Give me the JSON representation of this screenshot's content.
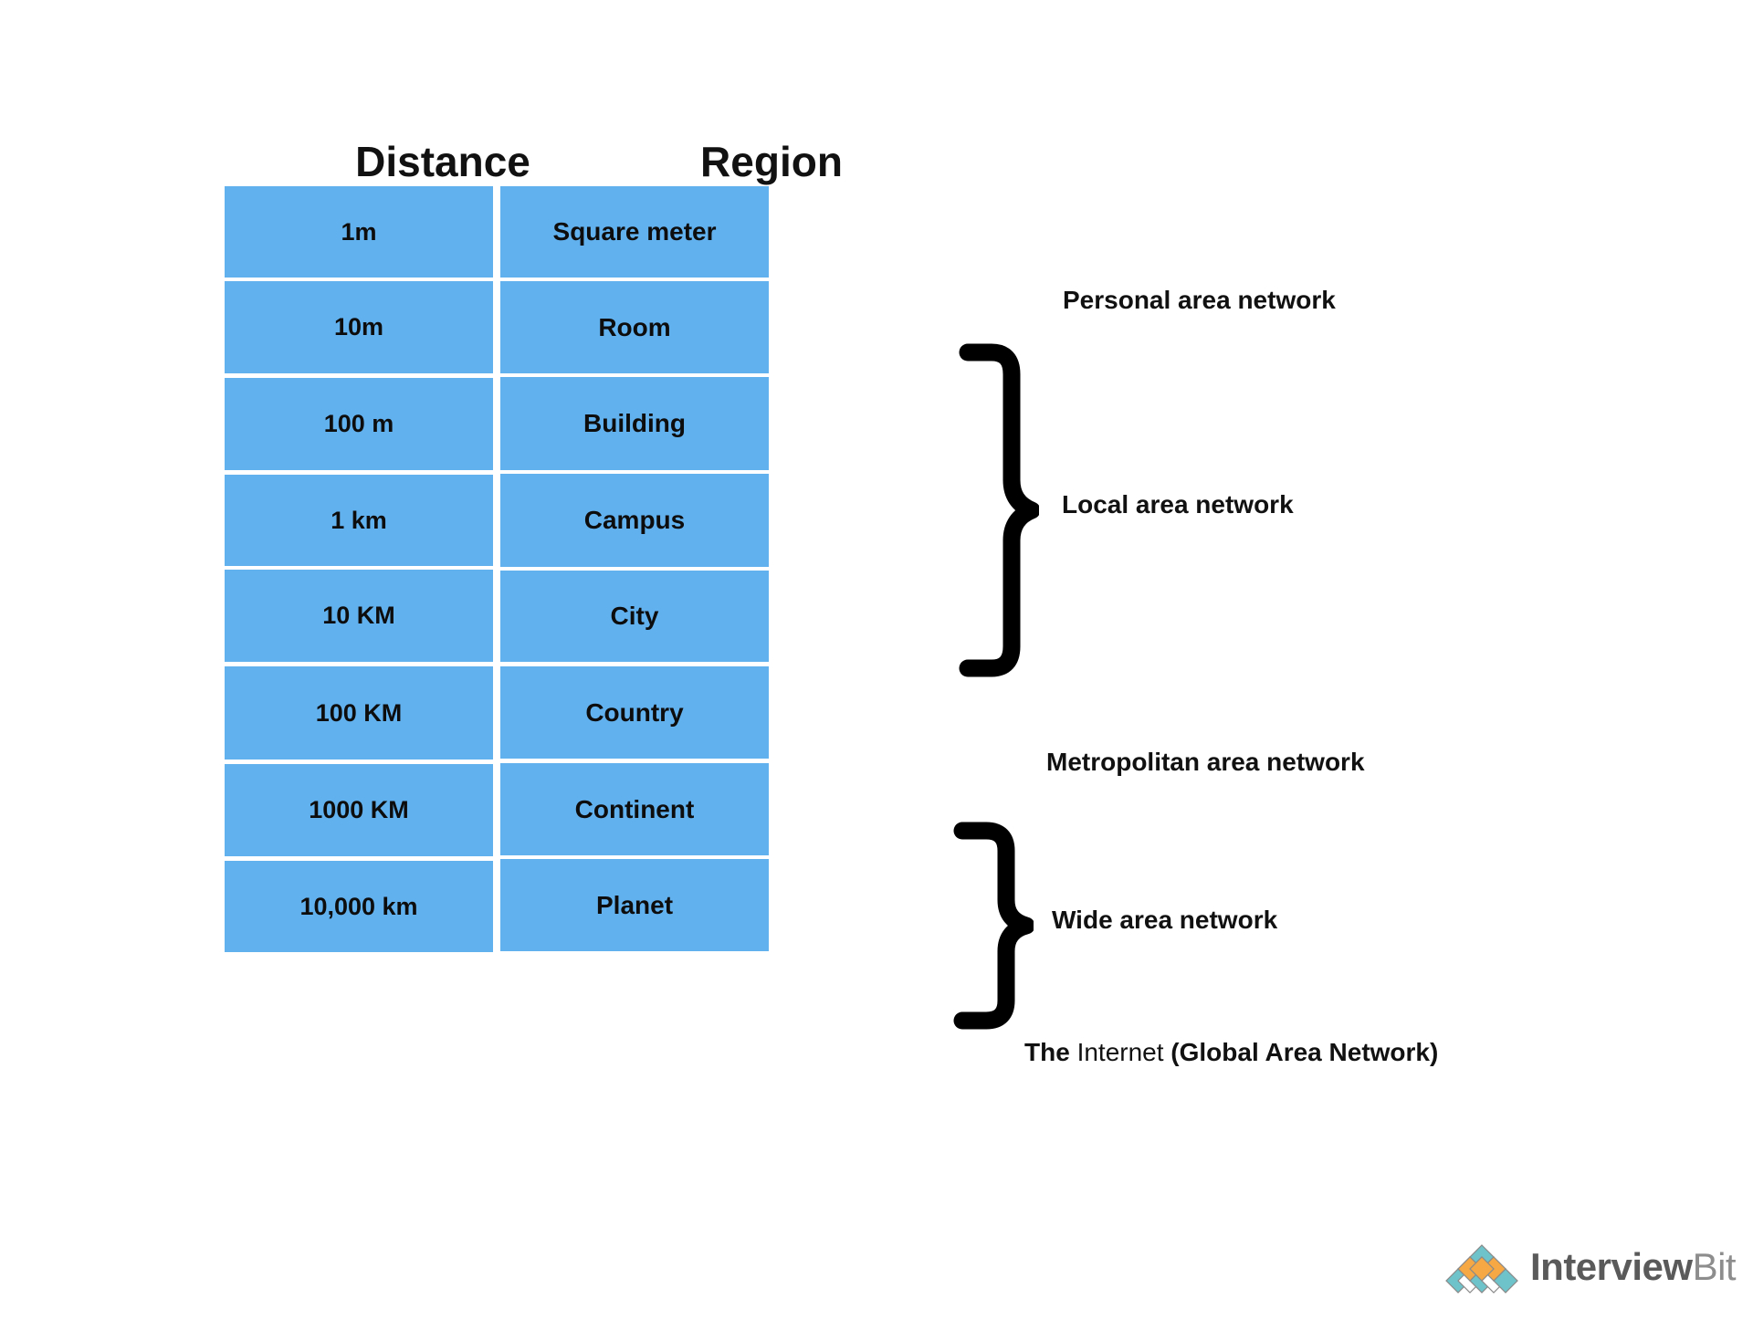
{
  "headers": {
    "distance": "Distance",
    "region": "Region"
  },
  "colors": {
    "cell_fill": "#62B1EF",
    "text": "#111111",
    "logo_teal": "#6DC3C9",
    "logo_orange": "#F5A843",
    "logo_gray_dark": "#5A5A5A",
    "logo_gray_light": "#8D8D8D"
  },
  "rows": [
    {
      "distance": "1m",
      "region": "Square meter"
    },
    {
      "distance": "10m",
      "region": "Room"
    },
    {
      "distance": "100 m",
      "region": "Building"
    },
    {
      "distance": "1 km",
      "region": "Campus"
    },
    {
      "distance": "10 KM",
      "region": "City"
    },
    {
      "distance": "100 KM",
      "region": "Country"
    },
    {
      "distance": "1000 KM",
      "region": "Continent"
    },
    {
      "distance": "10,000 km",
      "region": "Planet"
    }
  ],
  "annotations": [
    {
      "label": "Personal area network",
      "brace": false
    },
    {
      "label": "Local area network",
      "brace": true
    },
    {
      "label": "Metropolitan area network",
      "brace": false
    },
    {
      "label": "Wide area network",
      "brace": true
    }
  ],
  "internet_label": {
    "part1": "The ",
    "part2": "Internet ",
    "part3": "(Global Area Network)"
  },
  "logo": {
    "name_dark": "Interview",
    "name_light": "Bit"
  }
}
